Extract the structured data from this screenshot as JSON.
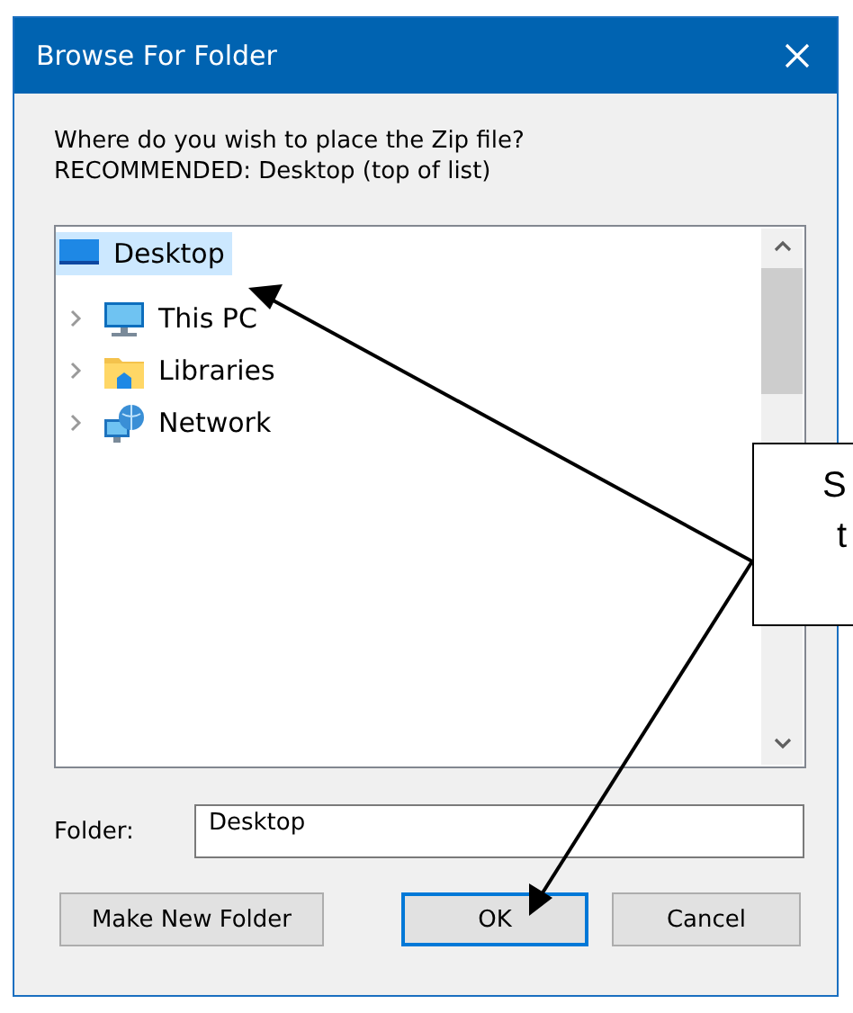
{
  "window": {
    "title": "Browse For Folder"
  },
  "message": [
    "Where do you wish to place the Zip file?",
    "RECOMMENDED: Desktop (top of list)"
  ],
  "tree": [
    {
      "label": "Desktop",
      "kind": "desktop",
      "selected": true,
      "children": [
        {
          "label": "This PC",
          "kind": "computer",
          "selected": false,
          "expanded": false
        },
        {
          "label": "Libraries",
          "kind": "libraries",
          "selected": false,
          "expanded": false
        },
        {
          "label": "Network",
          "kind": "network",
          "selected": false,
          "expanded": false
        }
      ]
    }
  ],
  "folder": {
    "label": "Folder:",
    "value": "Desktop"
  },
  "buttons": [
    {
      "label": "Make New Folder",
      "default": false
    },
    {
      "label": "OK",
      "default": true
    },
    {
      "label": "Cancel",
      "default": false
    }
  ],
  "callout": {
    "lines": [
      "S",
      "t"
    ]
  }
}
